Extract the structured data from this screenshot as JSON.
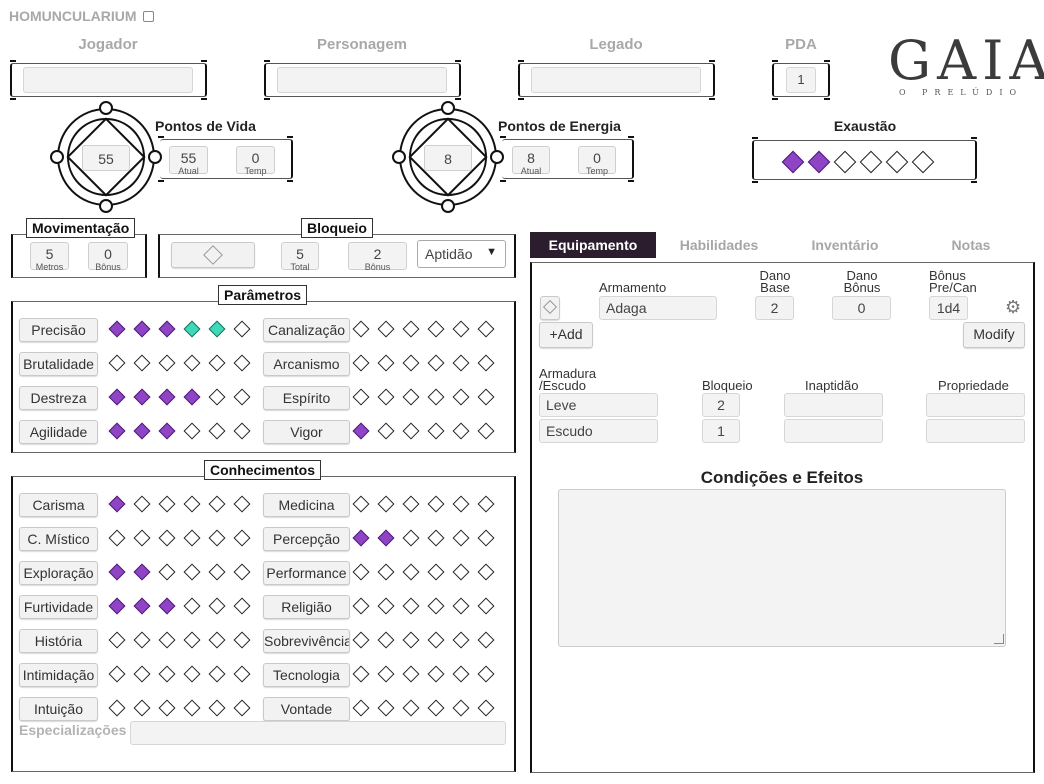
{
  "app_title": "HOMUNCULARIUM",
  "header": {
    "jogador_label": "Jogador",
    "personagem_label": "Personagem",
    "legado_label": "Legado",
    "pda_label": "PDA",
    "pda_value": "1",
    "jogador_value": "",
    "personagem_value": "",
    "legado_value": ""
  },
  "logo": {
    "word": "GAIA",
    "sub": "O PRELÚDIO"
  },
  "vida": {
    "label": "Pontos de Vida",
    "max": "55",
    "atual": "55",
    "atual_label": "Atual",
    "temp": "0",
    "temp_label": "Temp"
  },
  "energia": {
    "label": "Pontos de Energia",
    "max": "8",
    "atual": "8",
    "atual_label": "Atual",
    "temp": "0",
    "temp_label": "Temp"
  },
  "exaustao": {
    "label": "Exaustão",
    "filled": 2,
    "total": 6
  },
  "movimentacao": {
    "label": "Movimentação",
    "metros": "5",
    "metros_label": "Metros",
    "bonus": "0",
    "bonus_label": "Bônus"
  },
  "bloqueio": {
    "label": "Bloqueio",
    "total": "5",
    "total_label": "Total",
    "bonus": "2",
    "bonus_label": "Bônus",
    "select_value": "Aptidão"
  },
  "parametros": {
    "title": "Parâmetros",
    "left": [
      {
        "label": "Precisão",
        "dots": [
          "p",
          "p",
          "p",
          "t",
          "t",
          "e"
        ]
      },
      {
        "label": "Brutalidade",
        "dots": [
          "e",
          "e",
          "e",
          "e",
          "e",
          "e"
        ]
      },
      {
        "label": "Destreza",
        "dots": [
          "p",
          "p",
          "p",
          "p",
          "e",
          "e"
        ]
      },
      {
        "label": "Agilidade",
        "dots": [
          "p",
          "p",
          "p",
          "e",
          "e",
          "e"
        ]
      }
    ],
    "right": [
      {
        "label": "Canalização",
        "dots": [
          "e",
          "e",
          "e",
          "e",
          "e",
          "e"
        ]
      },
      {
        "label": "Arcanismo",
        "dots": [
          "e",
          "e",
          "e",
          "e",
          "e",
          "e"
        ]
      },
      {
        "label": "Espírito",
        "dots": [
          "e",
          "e",
          "e",
          "e",
          "e",
          "e"
        ]
      },
      {
        "label": "Vigor",
        "dots": [
          "p",
          "e",
          "e",
          "e",
          "e",
          "e"
        ]
      }
    ]
  },
  "conhecimentos": {
    "title": "Conhecimentos",
    "left": [
      {
        "label": "Carisma",
        "dots": [
          "p",
          "e",
          "e",
          "e",
          "e",
          "e"
        ]
      },
      {
        "label": "C. Místico",
        "dots": [
          "e",
          "e",
          "e",
          "e",
          "e",
          "e"
        ]
      },
      {
        "label": "Exploração",
        "dots": [
          "p",
          "p",
          "e",
          "e",
          "e",
          "e"
        ]
      },
      {
        "label": "Furtividade",
        "dots": [
          "p",
          "p",
          "p",
          "e",
          "e",
          "e"
        ]
      },
      {
        "label": "História",
        "dots": [
          "e",
          "e",
          "e",
          "e",
          "e",
          "e"
        ]
      },
      {
        "label": "Intimidação",
        "dots": [
          "e",
          "e",
          "e",
          "e",
          "e",
          "e"
        ]
      },
      {
        "label": "Intuição",
        "dots": [
          "e",
          "e",
          "e",
          "e",
          "e",
          "e"
        ]
      }
    ],
    "right": [
      {
        "label": "Medicina",
        "dots": [
          "e",
          "e",
          "e",
          "e",
          "e",
          "e"
        ]
      },
      {
        "label": "Percepção",
        "dots": [
          "p",
          "p",
          "e",
          "e",
          "e",
          "e"
        ]
      },
      {
        "label": "Performance",
        "dots": [
          "e",
          "e",
          "e",
          "e",
          "e",
          "e"
        ]
      },
      {
        "label": "Religião",
        "dots": [
          "e",
          "e",
          "e",
          "e",
          "e",
          "e"
        ]
      },
      {
        "label": "Sobrevivência",
        "dots": [
          "e",
          "e",
          "e",
          "e",
          "e",
          "e"
        ]
      },
      {
        "label": "Tecnologia",
        "dots": [
          "e",
          "e",
          "e",
          "e",
          "e",
          "e"
        ]
      },
      {
        "label": "Vontade",
        "dots": [
          "e",
          "e",
          "e",
          "e",
          "e",
          "e"
        ]
      }
    ],
    "especializacoes_label": "Especializações",
    "especializacoes_value": ""
  },
  "tabs": [
    {
      "label": "Equipamento",
      "active": true
    },
    {
      "label": "Habilidades",
      "active": false
    },
    {
      "label": "Inventário",
      "active": false
    },
    {
      "label": "Notas",
      "active": false
    }
  ],
  "equipamento": {
    "armamento_label": "Armamento",
    "armamento_value": "Adaga",
    "dano_base_label1": "Dano",
    "dano_base_label2": "Base",
    "dano_base_value": "2",
    "dano_bonus_label1": "Dano",
    "dano_bonus_label2": "Bônus",
    "dano_bonus_value": "0",
    "bonus_precan_label1": "Bônus",
    "bonus_precan_label2": "Pre/Can",
    "bonus_precan_value": "1d4",
    "add_label": "+Add",
    "modify_label": "Modify",
    "armadura_label1": "Armadura",
    "armadura_label2": "/Escudo",
    "bloqueio_label": "Bloqueio",
    "inaptidao_label": "Inaptidão",
    "propriedade_label": "Propriedade",
    "armor_rows": [
      {
        "name": "Leve",
        "bloqueio": "2",
        "inaptidao": "",
        "propriedade": ""
      },
      {
        "name": "Escudo",
        "bloqueio": "1",
        "inaptidao": "",
        "propriedade": ""
      }
    ],
    "condicoes_title": "Condições e Efeitos",
    "condicoes_value": ""
  }
}
